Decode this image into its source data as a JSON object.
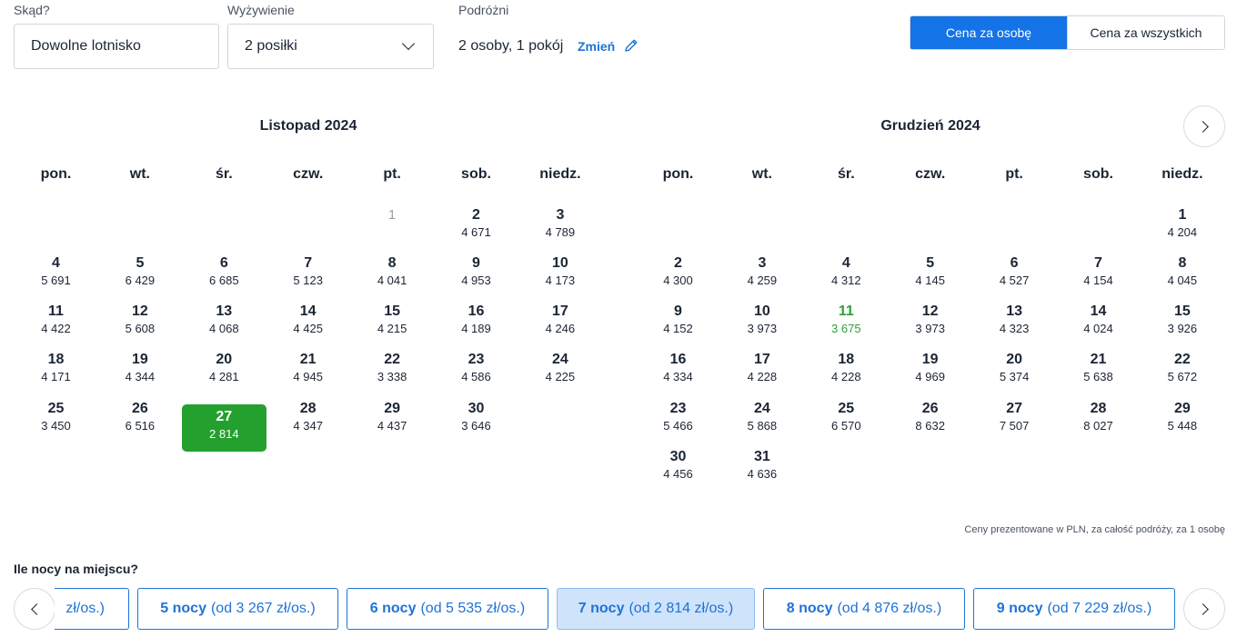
{
  "filters": {
    "from_label": "Skąd?",
    "from_value": "Dowolne lotnisko",
    "board_label": "Wyżywienie",
    "board_value": "2 posiłki",
    "travellers_label": "Podróżni",
    "travellers_value": "2 osoby, 1 pokój",
    "change_label": "Zmień"
  },
  "price_toggle": {
    "per_person": "Cena za osobę",
    "total": "Cena za wszystkich",
    "active": "per_person"
  },
  "weekdays": [
    "pon.",
    "wt.",
    "śr.",
    "czw.",
    "pt.",
    "sob.",
    "niedz."
  ],
  "months": [
    {
      "title": "Listopad 2024",
      "first_weekday": 4,
      "days": [
        {
          "d": "1",
          "p": "",
          "state": "disabled"
        },
        {
          "d": "2",
          "p": "4 671"
        },
        {
          "d": "3",
          "p": "4 789"
        },
        {
          "d": "4",
          "p": "5 691"
        },
        {
          "d": "5",
          "p": "6 429"
        },
        {
          "d": "6",
          "p": "6 685"
        },
        {
          "d": "7",
          "p": "5 123"
        },
        {
          "d": "8",
          "p": "4 041"
        },
        {
          "d": "9",
          "p": "4 953"
        },
        {
          "d": "10",
          "p": "4 173"
        },
        {
          "d": "11",
          "p": "4 422"
        },
        {
          "d": "12",
          "p": "5 608"
        },
        {
          "d": "13",
          "p": "4 068"
        },
        {
          "d": "14",
          "p": "4 425"
        },
        {
          "d": "15",
          "p": "4 215"
        },
        {
          "d": "16",
          "p": "4 189"
        },
        {
          "d": "17",
          "p": "4 246"
        },
        {
          "d": "18",
          "p": "4 171"
        },
        {
          "d": "19",
          "p": "4 344"
        },
        {
          "d": "20",
          "p": "4 281"
        },
        {
          "d": "21",
          "p": "4 945"
        },
        {
          "d": "22",
          "p": "3 338"
        },
        {
          "d": "23",
          "p": "4 586"
        },
        {
          "d": "24",
          "p": "4 225"
        },
        {
          "d": "25",
          "p": "3 450"
        },
        {
          "d": "26",
          "p": "6 516"
        },
        {
          "d": "27",
          "p": "2 814",
          "state": "selected"
        },
        {
          "d": "28",
          "p": "4 347"
        },
        {
          "d": "29",
          "p": "4 437"
        },
        {
          "d": "30",
          "p": "3 646"
        }
      ]
    },
    {
      "title": "Grudzień 2024",
      "first_weekday": 6,
      "days": [
        {
          "d": "1",
          "p": "4 204"
        },
        {
          "d": "2",
          "p": "4 300"
        },
        {
          "d": "3",
          "p": "4 259"
        },
        {
          "d": "4",
          "p": "4 312"
        },
        {
          "d": "5",
          "p": "4 145"
        },
        {
          "d": "6",
          "p": "4 527"
        },
        {
          "d": "7",
          "p": "4 154"
        },
        {
          "d": "8",
          "p": "4 045"
        },
        {
          "d": "9",
          "p": "4 152"
        },
        {
          "d": "10",
          "p": "3 973"
        },
        {
          "d": "11",
          "p": "3 675",
          "state": "cheapest"
        },
        {
          "d": "12",
          "p": "3 973"
        },
        {
          "d": "13",
          "p": "4 323"
        },
        {
          "d": "14",
          "p": "4 024"
        },
        {
          "d": "15",
          "p": "3 926"
        },
        {
          "d": "16",
          "p": "4 334"
        },
        {
          "d": "17",
          "p": "4 228"
        },
        {
          "d": "18",
          "p": "4 228"
        },
        {
          "d": "19",
          "p": "4 969"
        },
        {
          "d": "20",
          "p": "5 374"
        },
        {
          "d": "21",
          "p": "5 638"
        },
        {
          "d": "22",
          "p": "5 672"
        },
        {
          "d": "23",
          "p": "5 466"
        },
        {
          "d": "24",
          "p": "5 868"
        },
        {
          "d": "25",
          "p": "6 570"
        },
        {
          "d": "26",
          "p": "8 632"
        },
        {
          "d": "27",
          "p": "7 507"
        },
        {
          "d": "28",
          "p": "8 027"
        },
        {
          "d": "29",
          "p": "5 448"
        },
        {
          "d": "30",
          "p": "4 456"
        },
        {
          "d": "31",
          "p": "4 636"
        }
      ]
    }
  ],
  "note": "Ceny prezentowane w PLN, za całość podróży, za 1 osobę",
  "nights": {
    "title": "Ile nocy na miejscu?",
    "partial_from": "zł/os.)",
    "options": [
      {
        "nights": "5 nocy",
        "from": "(od 3 267 zł/os.)"
      },
      {
        "nights": "6 nocy",
        "from": "(od 5 535 zł/os.)"
      },
      {
        "nights": "7 nocy",
        "from": "(od 2 814 zł/os.)",
        "selected": true
      },
      {
        "nights": "8 nocy",
        "from": "(od 4 876 zł/os.)"
      },
      {
        "nights": "9 nocy",
        "from": "(od 7 229 zł/os.)"
      }
    ]
  },
  "colors": {
    "accent": "#1473e6",
    "selected_day": "#24a02e",
    "cheapest_day": "#2ea03a",
    "selected_chip": "#cfe3fb"
  }
}
